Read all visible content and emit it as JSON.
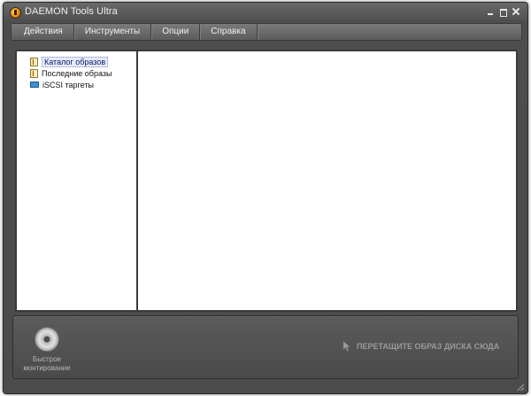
{
  "window": {
    "title": "DAEMON Tools Ultra",
    "controls": [
      "minimize-icon",
      "maximize-icon",
      "close-icon"
    ]
  },
  "menu": {
    "items": [
      "Действия",
      "Инструменты",
      "Опции",
      "Справка"
    ]
  },
  "tree": {
    "items": [
      {
        "label": "Каталог образов",
        "icon": "catalog-icon",
        "selected": true
      },
      {
        "label": "Последние образы",
        "icon": "recent-images-icon",
        "selected": false
      },
      {
        "label": "iSCSI таргеты",
        "icon": "network-icon",
        "selected": false
      }
    ]
  },
  "dock": {
    "quick_mount_line1": "Быстрое",
    "quick_mount_line2": "монтирование",
    "drop_hint": "ПЕРЕТАЩИТЕ ОБРАЗ ДИСКА СЮДА"
  }
}
